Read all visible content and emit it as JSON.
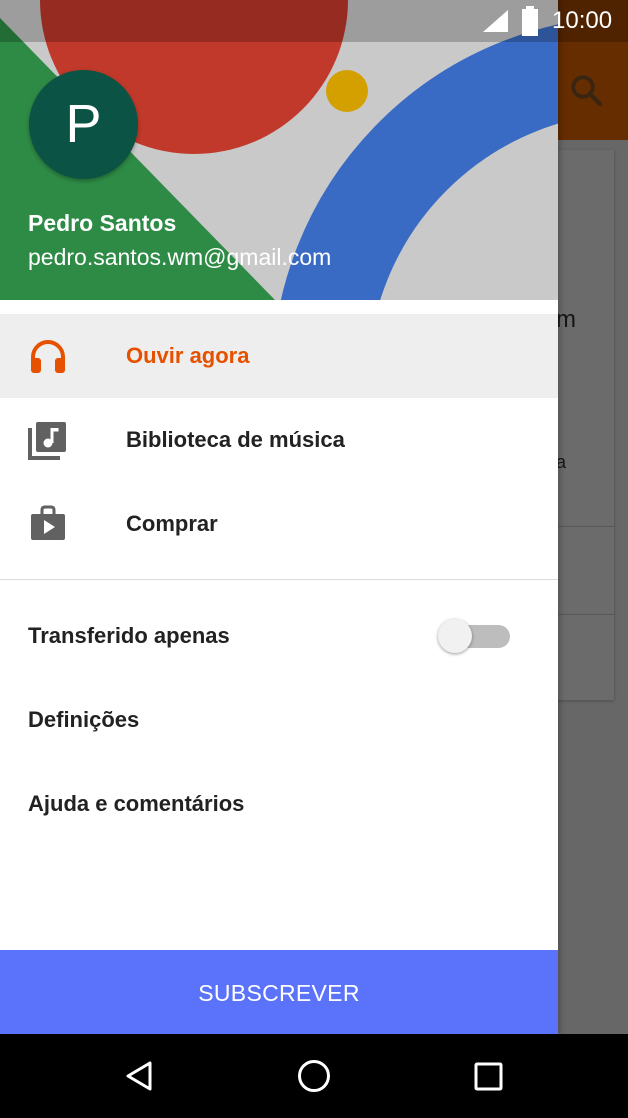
{
  "status_bar": {
    "time": "10:00"
  },
  "background": {
    "partial_text_1": "m",
    "partial_text_2": "a"
  },
  "drawer": {
    "avatar_letter": "P",
    "user_name": "Pedro Santos",
    "user_email": "pedro.santos.wm@gmail.com",
    "nav_items": [
      {
        "label": "Ouvir agora",
        "icon": "headphones-icon",
        "active": true
      },
      {
        "label": "Biblioteca de música",
        "icon": "music-library-icon",
        "active": false
      },
      {
        "label": "Comprar",
        "icon": "shop-bag-icon",
        "active": false
      }
    ],
    "settings": [
      {
        "label": "Transferido apenas",
        "toggle_on": false
      },
      {
        "label": "Definições"
      },
      {
        "label": "Ajuda e comentários"
      }
    ],
    "subscribe_label": "SUBSCREVER"
  },
  "colors": {
    "accent": "#e65100",
    "subscribe_button": "#5b72fb",
    "avatar": "#0b5345",
    "header_red": "#c0392b",
    "header_blue": "#3a6bc4",
    "header_green": "#2e8b46",
    "header_yellow": "#d4a000"
  }
}
